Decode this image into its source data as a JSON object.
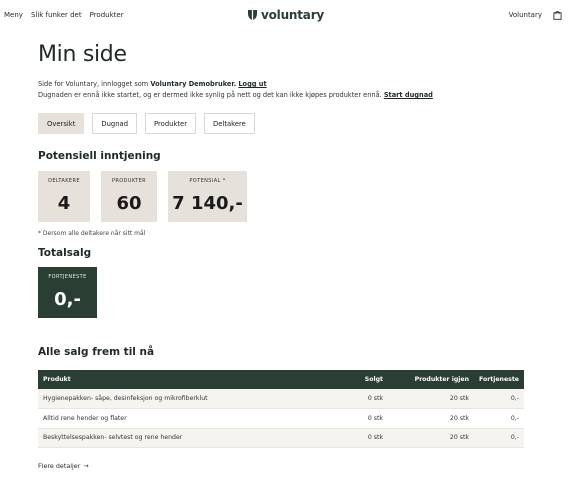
{
  "nav": {
    "left": [
      "Meny",
      "Slik funker det",
      "Produkter"
    ],
    "brand": "voluntary",
    "account": "Voluntary",
    "icons": {
      "logo": "voluntary-logo-mark",
      "cart": "shopping-bag-icon"
    }
  },
  "page": {
    "title": "Min side",
    "intro_prefix": "Side for Voluntary, innlogget som",
    "user": "Voluntary Demobruker.",
    "logout": "Logg ut",
    "notice": "Dugnaden er ennå ikke startet, og er dermed ikke synlig på nett og det kan ikke kjøpes produkter ennå.",
    "start_link": "Start dugnad"
  },
  "tabs": [
    {
      "label": "Oversikt",
      "active": true
    },
    {
      "label": "Dugnad",
      "active": false
    },
    {
      "label": "Produkter",
      "active": false
    },
    {
      "label": "Deltakere",
      "active": false
    }
  ],
  "earnings": {
    "title": "Potensiell inntjening",
    "stats": [
      {
        "label": "DELTAKERE",
        "value": "4"
      },
      {
        "label": "PRODUKTER",
        "value": "60"
      },
      {
        "label": "POTENSIAL *",
        "value": "7 140,-"
      }
    ],
    "footnote": "* Dersom alle deltakere når sitt mål"
  },
  "total": {
    "title": "Totalsalg",
    "label": "FORTJENESTE",
    "value": "0,-"
  },
  "sales": {
    "title": "Alle salg frem til nå",
    "columns": [
      "Produkt",
      "Solgt",
      "Produkter igjen",
      "Fortjeneste"
    ],
    "rows": [
      [
        "Hygienepakken- såpe, desinfeksjon og mikrofiberklut",
        "0 stk",
        "20 stk",
        "0,-"
      ],
      [
        "Alltid rene hender og flater",
        "0 stk",
        "20 stk",
        "0,-"
      ],
      [
        "Beskyttelsespakken- selvtest og rene hender",
        "0 stk",
        "20 stk",
        "0,-"
      ]
    ],
    "more": "Flere detaljer",
    "more_arrow": "→"
  },
  "colors": {
    "brand_green": "#2b3e34",
    "card_beige": "#e6e1da"
  }
}
